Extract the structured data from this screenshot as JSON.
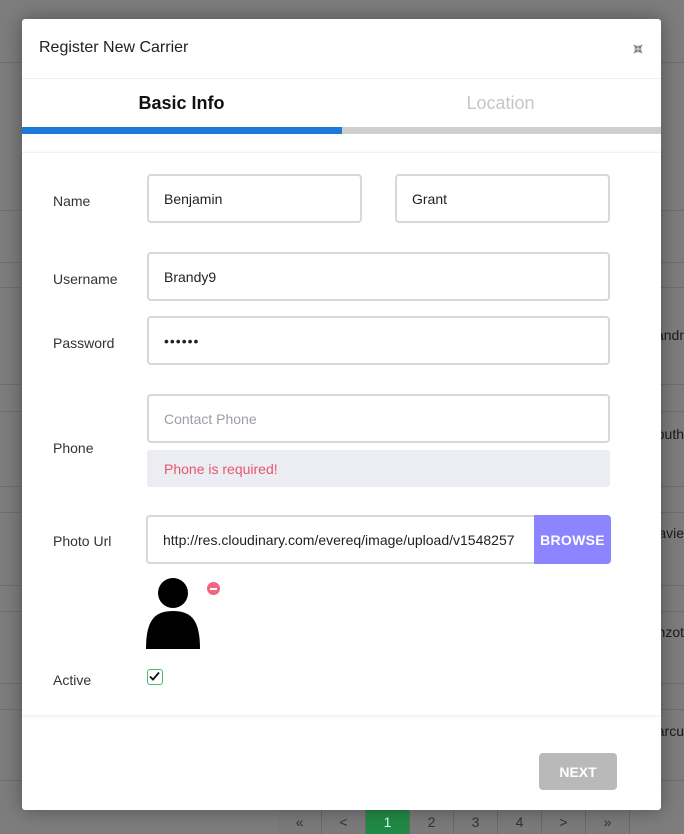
{
  "background": {
    "row_texts": [
      "andr",
      "outh",
      "avie",
      "nzot",
      "arcu"
    ],
    "pagination": [
      "«",
      "<",
      "1",
      "2",
      "3",
      "4",
      ">",
      "»"
    ],
    "active_page": "1"
  },
  "modal": {
    "title": "Register New Carrier",
    "tabs": [
      {
        "label": "Basic Info",
        "active": true
      },
      {
        "label": "Location",
        "active": false
      }
    ],
    "progress_fraction": 0.5,
    "form": {
      "name_label": "Name",
      "first_name": "Benjamin",
      "last_name": "Grant",
      "username_label": "Username",
      "username": "Brandy9",
      "password_label": "Password",
      "password_mask": "••••••",
      "phone_label": "Phone",
      "phone_placeholder": "Contact Phone",
      "phone_error": "Phone is required!",
      "photo_label": "Photo Url",
      "photo_url": "http://res.cloudinary.com/evereq/image/upload/v1548257",
      "browse_label": "BROWSE",
      "active_label": "Active",
      "active_checked": true
    },
    "next_label": "NEXT",
    "colors": {
      "accent_blue": "#1e79d8",
      "browse_purple": "#8c85ff",
      "error_red": "#e7566f",
      "checkbox_green": "#3cc16a"
    }
  }
}
